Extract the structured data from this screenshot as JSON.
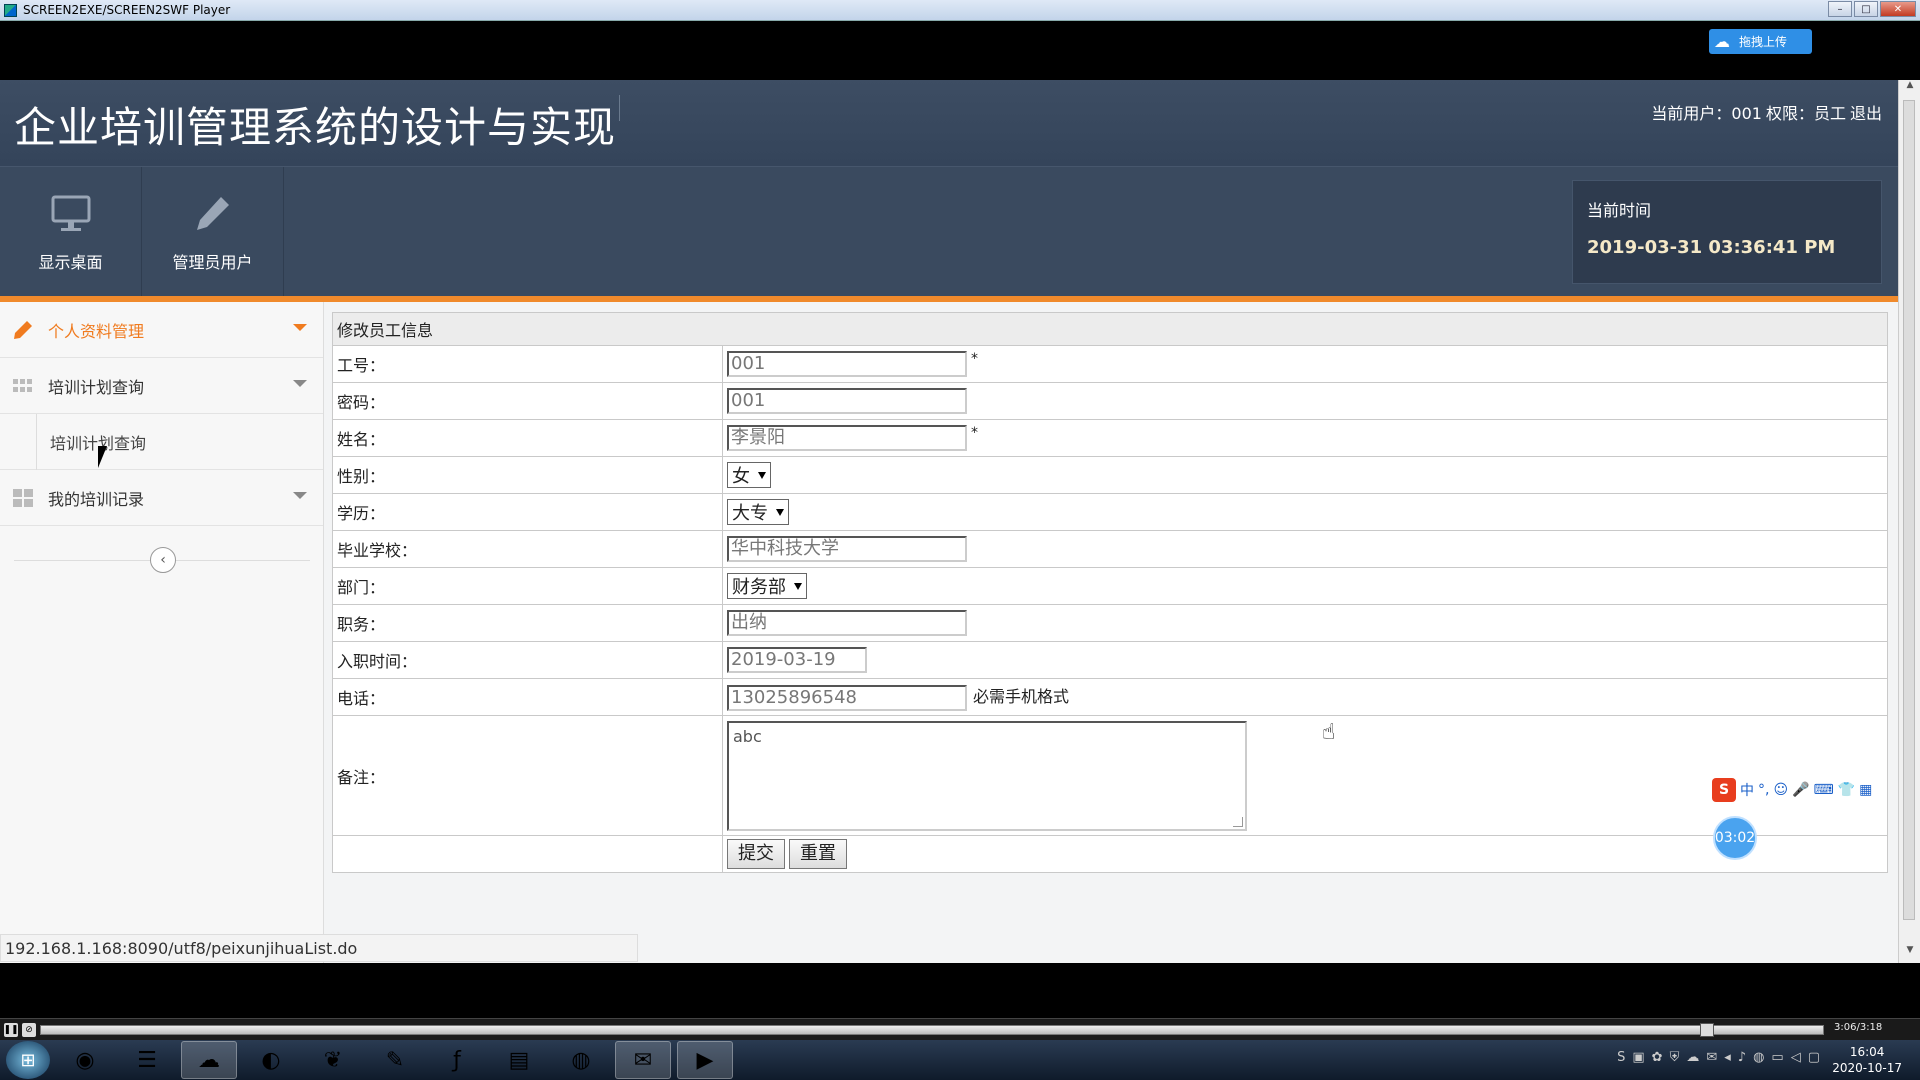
{
  "window": {
    "title": "SCREEN2EXE/SCREEN2SWF Player"
  },
  "upload_button": {
    "label": "拖拽上传"
  },
  "header": {
    "title": "企业培训管理系统的设计与实现",
    "user_label": "当前用户：001",
    "role_label": "权限：员工",
    "logout": "退出"
  },
  "toolbar": {
    "items": [
      {
        "label": "显示桌面",
        "icon": "monitor-icon"
      },
      {
        "label": "管理员用户",
        "icon": "pencil-icon"
      }
    ],
    "clock": {
      "heading": "当前时间",
      "value": "2019-03-31 03:36:41 PM"
    }
  },
  "sidebar": {
    "menus": [
      {
        "label": "个人资料管理",
        "icon": "pencil-icon",
        "active": true
      },
      {
        "label": "培训计划查询",
        "icon": "grid-icon"
      },
      {
        "sub_label": "培训计划查询"
      },
      {
        "label": "我的培训记录",
        "icon": "blocks-icon"
      }
    ],
    "collapse_icon": "chevron-left-icon"
  },
  "form": {
    "caption": "修改员工信息",
    "fields": {
      "id": {
        "label": "工号：",
        "value": "001",
        "required": "*"
      },
      "password": {
        "label": "密码：",
        "value": "001"
      },
      "name": {
        "label": "姓名：",
        "value": "李景阳",
        "required": "*"
      },
      "gender": {
        "label": "性别：",
        "value": "女"
      },
      "education": {
        "label": "学历：",
        "value": "大专"
      },
      "school": {
        "label": "毕业学校：",
        "value": "华中科技大学"
      },
      "department": {
        "label": "部门：",
        "value": "财务部"
      },
      "position": {
        "label": "职务：",
        "value": "出纳"
      },
      "hire_date": {
        "label": "入职时间：",
        "value": "2019-03-19"
      },
      "phone": {
        "label": "电话：",
        "value": "13025896548",
        "hint": "必需手机格式"
      },
      "remark": {
        "label": "备注：",
        "value": "abc"
      }
    },
    "submit": "提交",
    "reset": "重置"
  },
  "status_url": "192.168.1.168:8090/utf8/peixunjihuaList.do",
  "ime": {
    "label": "中"
  },
  "rec_timer": "03:02",
  "player": {
    "time": "3:06/3:18"
  },
  "system_clock": {
    "time": "16:04",
    "date": "2020-10-17"
  }
}
